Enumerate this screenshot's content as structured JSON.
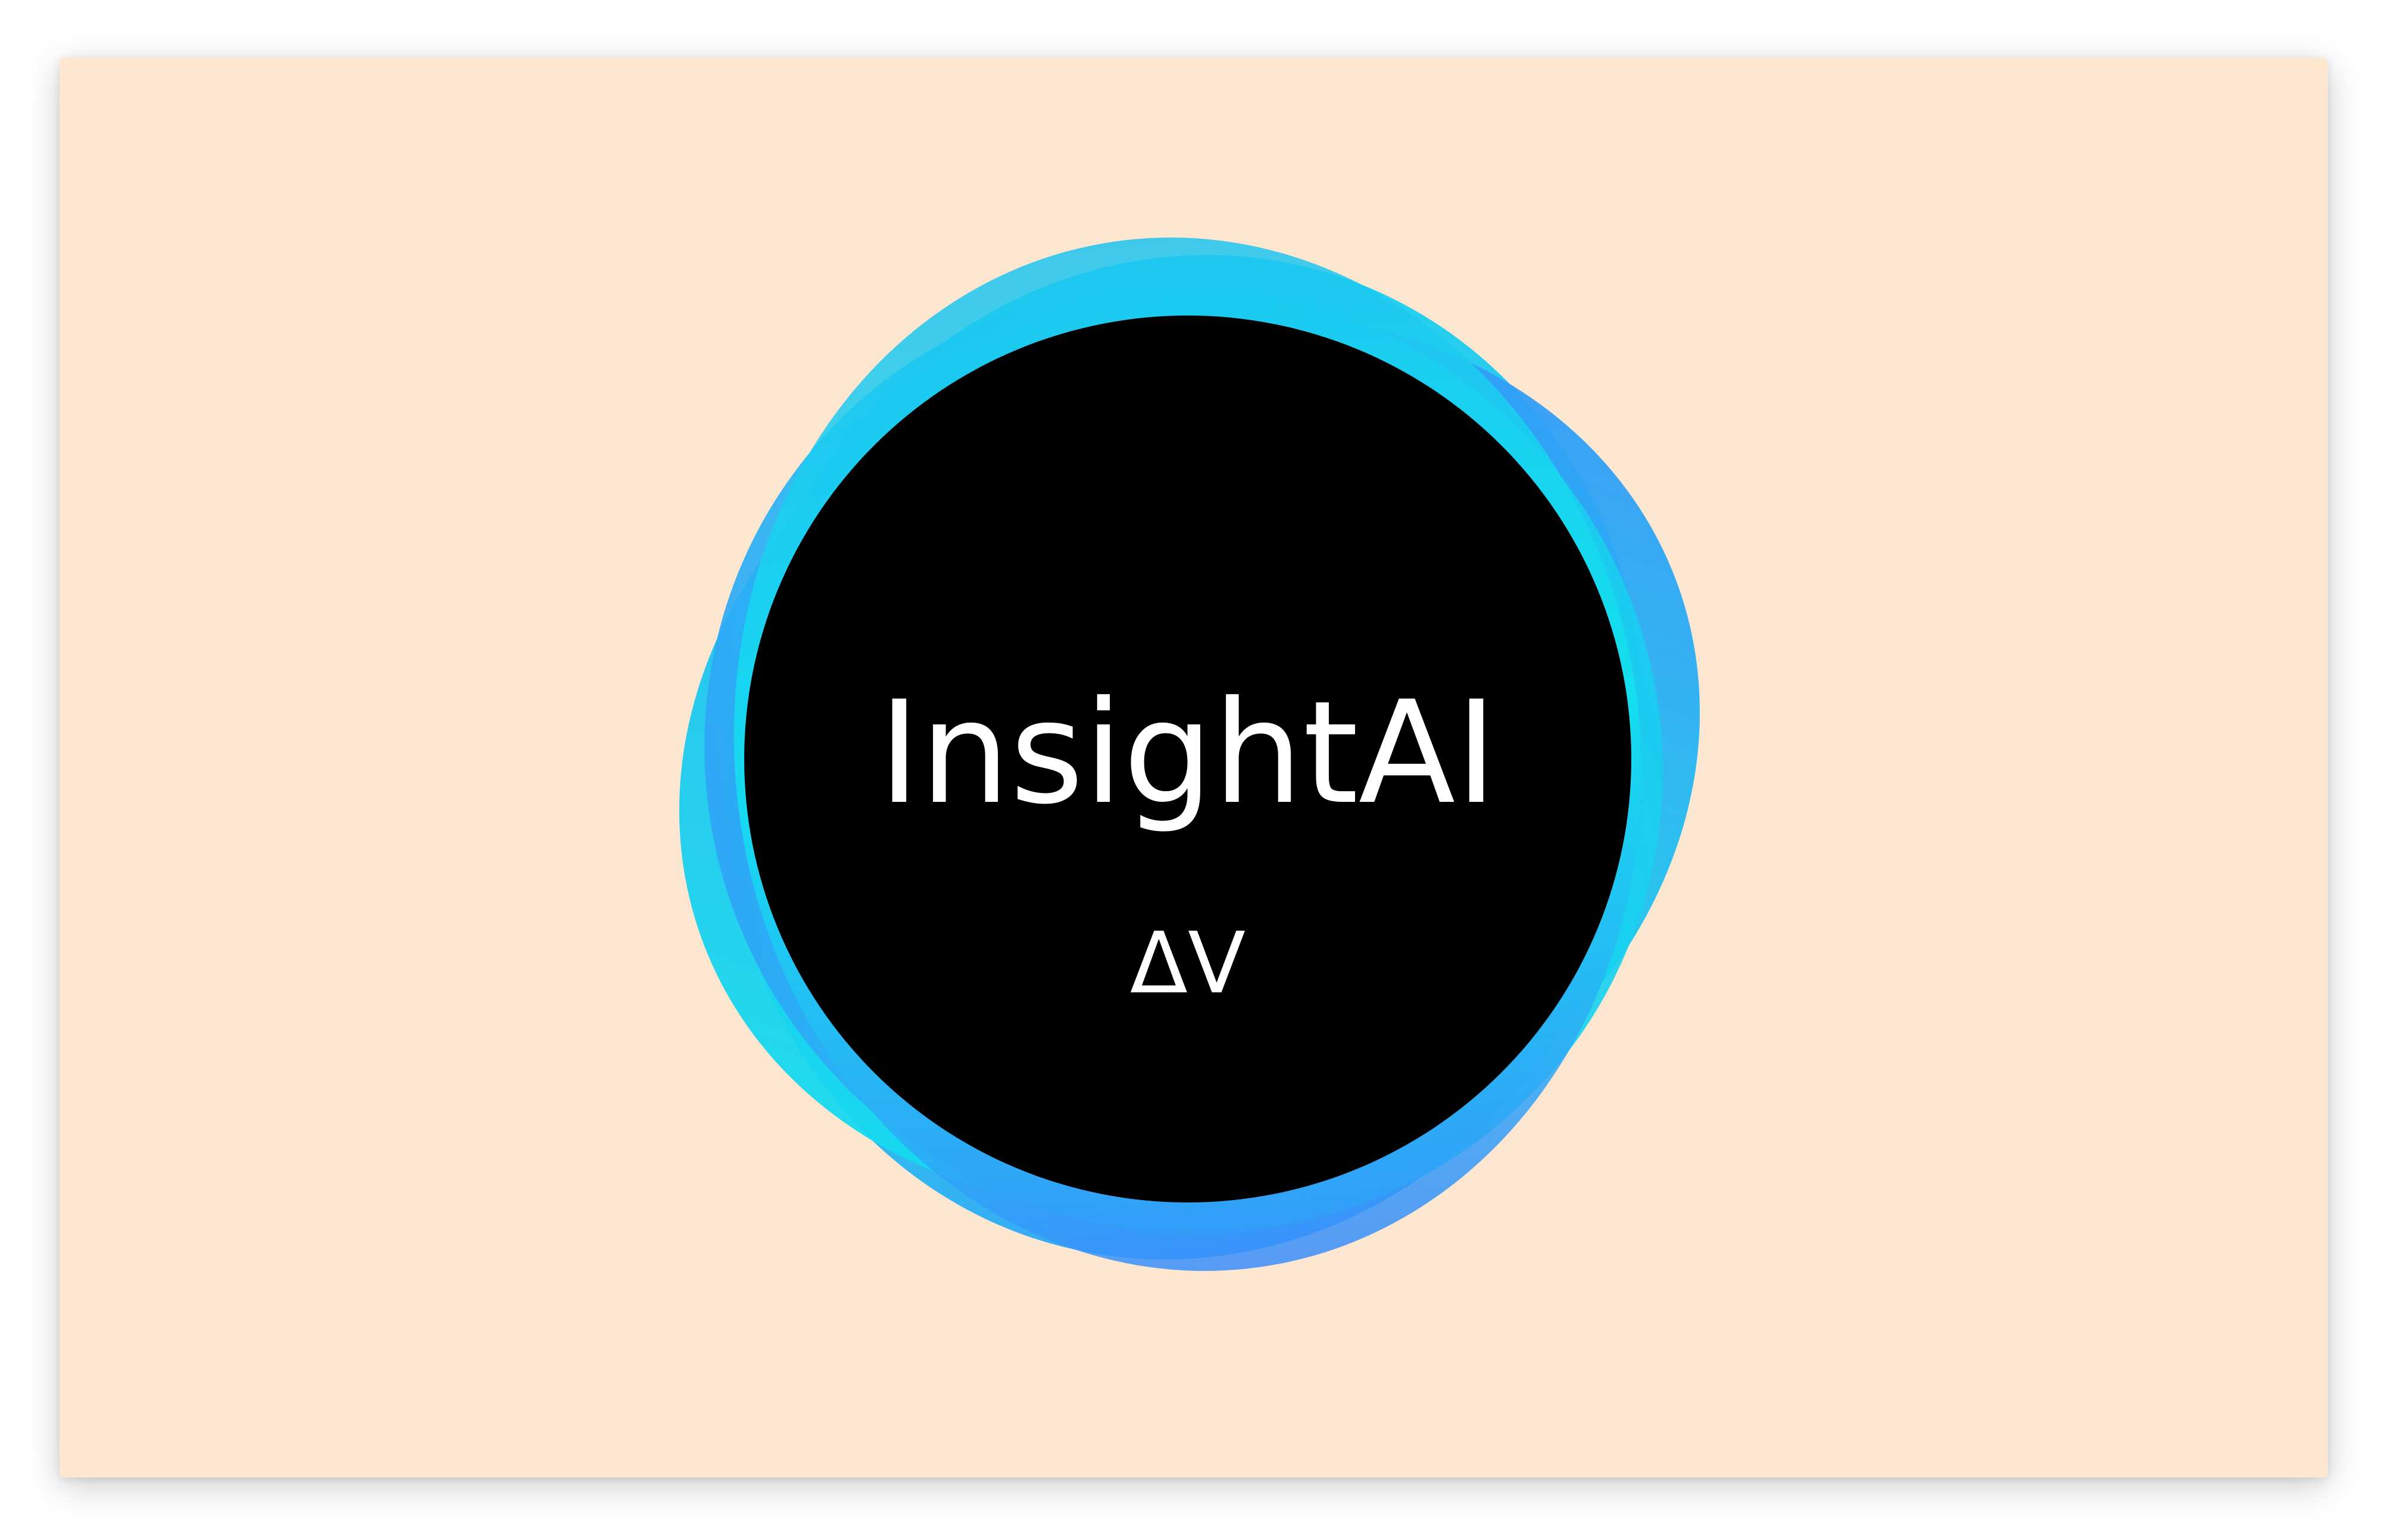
{
  "colors": {
    "background": "#FEE7D0",
    "disc": "#000000",
    "text": "#FFFFFF",
    "ring_cyan": "#12E3EE",
    "ring_sky": "#1FC3F0",
    "ring_blue": "#3A8DFB"
  },
  "logo": {
    "title": "InsightAI",
    "subtitle": "ΔV"
  },
  "icons": {
    "ring": "swirl-ring-icon",
    "disc": "black-disc"
  }
}
